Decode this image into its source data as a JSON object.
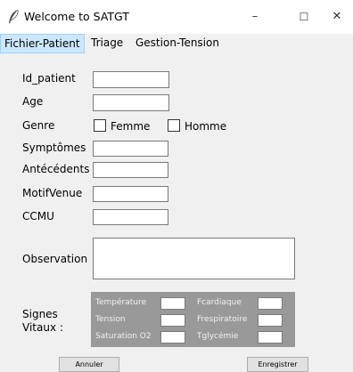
{
  "window": {
    "title": "Welcome to SATGT",
    "minimize_glyph": "–",
    "maximize_glyph": "☐",
    "close_glyph": "✕"
  },
  "menu": {
    "items": [
      "Fichier-Patient",
      "Triage",
      "Gestion-Tension"
    ],
    "active_index": 0
  },
  "form": {
    "id_patient_label": "Id_patient",
    "age_label": "Age",
    "genre_label": "Genre",
    "genre_femme": "Femme",
    "genre_homme": "Homme",
    "symptomes_label": "Symptômes",
    "antecedents_label": "Antécédents",
    "motif_label": "MotifVenue",
    "ccmu_label": "CCMU",
    "observation_label": "Observation",
    "signes_label_1": "Signes",
    "signes_label_2": "Vitaux :"
  },
  "vitals": {
    "temperature": "Température",
    "fcardiaque": "Fcardiaque",
    "tension": "Tension",
    "frespiratoire": "Frespiratoire",
    "saturation": "Saturation O2",
    "tglycemie": "Tglycémie"
  },
  "buttons": {
    "annuler": "Annuler",
    "enregistrer": "Enregistrer"
  },
  "colors": {
    "active_menu_bg": "#cce8ff",
    "vitals_panel_bg": "#999999"
  },
  "icons": {
    "app": "feather-icon"
  }
}
